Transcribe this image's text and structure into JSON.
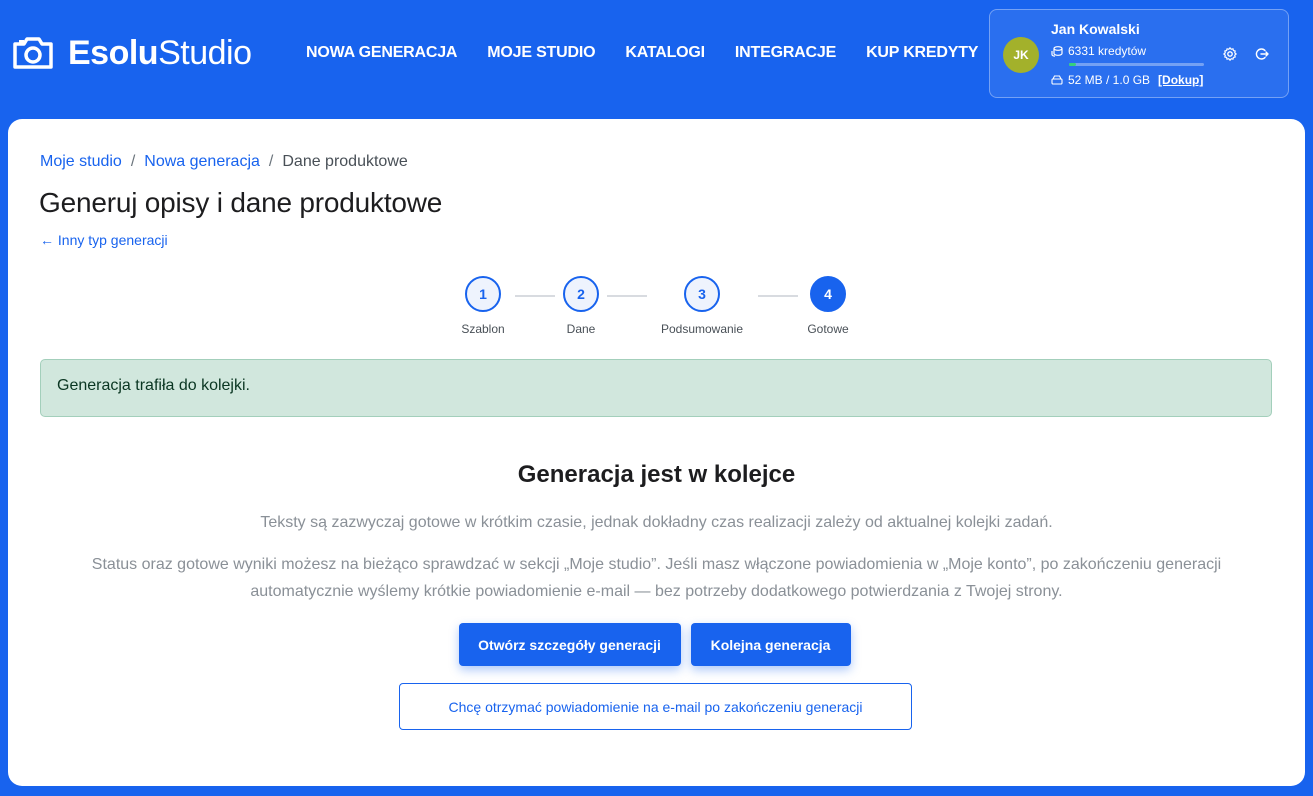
{
  "header": {
    "logo_bold": "Esolu",
    "logo_light": "Studio",
    "nav": [
      {
        "label": "NOWA GENERACJA"
      },
      {
        "label": "MOJE STUDIO"
      },
      {
        "label": "KATALOGI"
      },
      {
        "label": "INTEGRACJE"
      },
      {
        "label": "KUP KREDYTY"
      }
    ],
    "user": {
      "initials": "JK",
      "name": "Jan Kowalski",
      "credits": "6331 kredytów",
      "storage": "52 MB / 1.0 GB",
      "topup": "[Dokup]",
      "storage_used_fraction": 0.05
    }
  },
  "breadcrumb": {
    "items": [
      {
        "label": "Moje studio"
      },
      {
        "label": "Nowa generacja"
      },
      {
        "label": "Dane produktowe"
      }
    ],
    "separator": "/"
  },
  "page": {
    "title": "Generuj opisy i dane produktowe",
    "back_link": "← Inny typ generacji"
  },
  "stepper": {
    "steps": [
      {
        "number": "1",
        "label": "Szablon"
      },
      {
        "number": "2",
        "label": "Dane"
      },
      {
        "number": "3",
        "label": "Podsumowanie"
      },
      {
        "number": "4",
        "label": "Gotowe"
      }
    ],
    "active_step": 4
  },
  "alert": {
    "text": "Generacja trafiła do kolejki."
  },
  "queue": {
    "title": "Generacja jest w kolejce",
    "paragraph1": "Teksty są zazwyczaj gotowe w krótkim czasie, jednak dokładny czas realizacji zależy od aktualnej kolejki zadań.",
    "paragraph2": "Status oraz gotowe wyniki możesz na bieżąco sprawdzać w sekcji „Moje studio”. Jeśli masz włączone powiadomienia w „Moje konto”, po zakończeniu generacji automatycznie wyślemy krótkie powiadomienie e-mail — bez potrzeby dodatkowego potwierdzania z Twojej strony.",
    "open_details_button": "Otwórz szczegóły generacji",
    "next_generation_button": "Kolejna generacja",
    "notify_button": "Chcę otrzymać powiadomienie na e-mail po zakończeniu generacji"
  },
  "colors": {
    "brand": "#1863ee",
    "success_bg": "#d1e7dd",
    "avatar": "#a3b12b"
  }
}
